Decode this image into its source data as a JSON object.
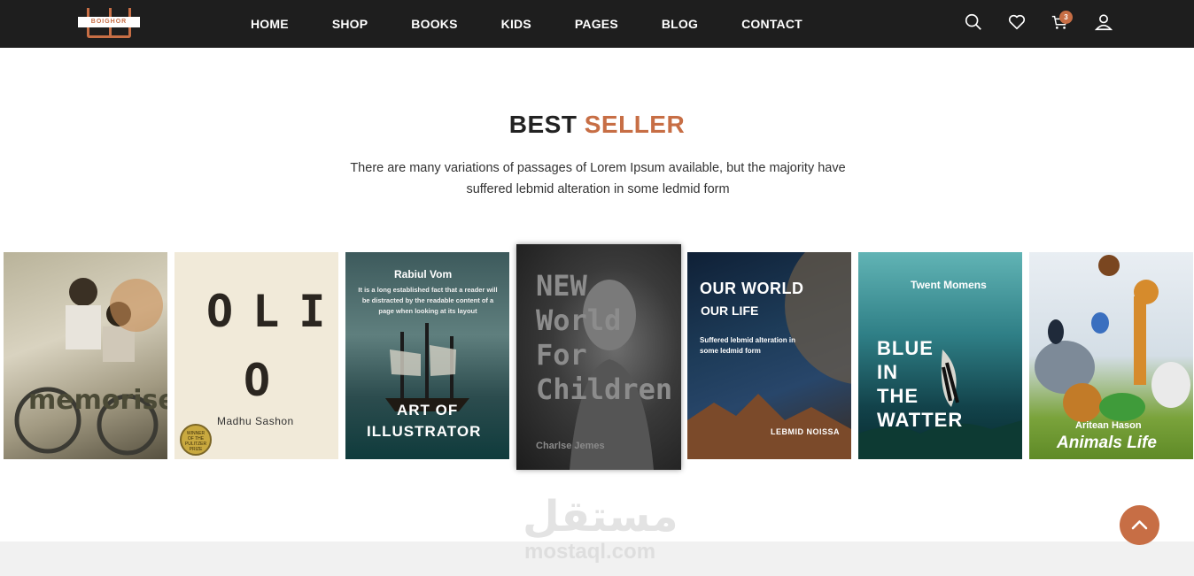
{
  "brand": {
    "logo_text": "BOIGHOR",
    "accent": "#c76e45",
    "nav_bg": "#1e1e1e"
  },
  "nav": {
    "items": [
      "HOME",
      "SHOP",
      "BOOKS",
      "KIDS",
      "PAGES",
      "BLOG",
      "CONTACT"
    ]
  },
  "header_icons": {
    "search": "search-icon",
    "wishlist": "heart-icon",
    "cart": "cart-icon",
    "cart_count": "3",
    "account": "user-icon"
  },
  "section": {
    "title_part1": "BEST",
    "title_part2": "SELLER",
    "description_line1": "There are many variations of passages of Lorem Ipsum available, but the majority have",
    "description_line2": "suffered lebmid alteration in some ledmid form"
  },
  "books": [
    {
      "title": "memorise"
    },
    {
      "title_l1": "OLIO",
      "title_l2": "O",
      "author": "Madhu Sashon",
      "seal": "WINNER OF THE PULITZER PRIZE"
    },
    {
      "author": "Rabiul Vom",
      "blurb": "It is a long established fact that a reader will be distracted by the readable content of a page when looking at its layout",
      "title_l1": "ART OF",
      "title_l2": "ILLUSTRATOR"
    },
    {
      "title_l1": "NEW",
      "title_l2": "World",
      "title_l3": "For",
      "title_l4": "Children",
      "author": "Charlse Jemes"
    },
    {
      "title_l1": "OUR WORLD",
      "title_l2": "OUR LIFE",
      "blurb": "Suffered lebmid alteration in some ledmid form",
      "author": "LEBMID NOISSA"
    },
    {
      "author": "Twent Momens",
      "title_l1": "BLUE",
      "title_l2": "IN",
      "title_l3": "THE",
      "title_l4": "WATTER"
    },
    {
      "author": "Aritean Hason",
      "title": "Animals Life"
    }
  ],
  "watermark": {
    "arabic": "مستقل",
    "latin": "mostaql.com"
  },
  "scroll_top": "chevron-up-icon"
}
